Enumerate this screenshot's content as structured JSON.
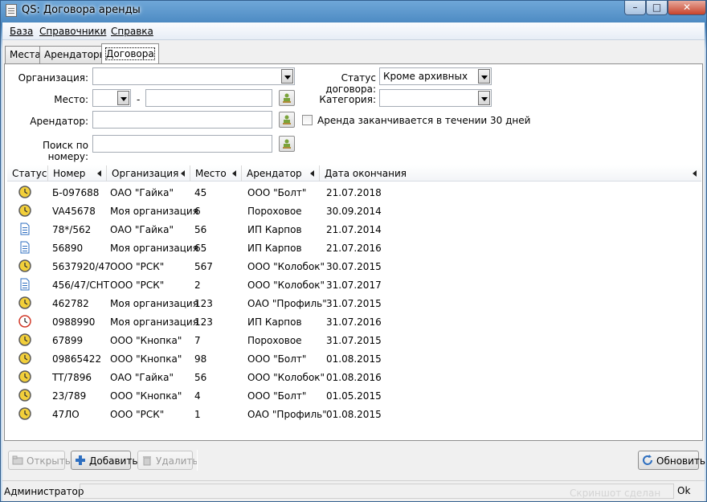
{
  "window": {
    "title": "QS: Договора аренды",
    "min_glyph": "–",
    "max_glyph": "□",
    "close_glyph": "✕"
  },
  "menu": [
    {
      "label": "База"
    },
    {
      "label": "Справочники"
    },
    {
      "label": "Справка"
    }
  ],
  "tabs": [
    {
      "label": "Места"
    },
    {
      "label": "Арендаторы"
    },
    {
      "label": "Договора"
    }
  ],
  "filters": {
    "org_label": "Организация:",
    "org_value": "",
    "place_label": "Место:",
    "place_value": "",
    "place_dash": "-",
    "place_value2": "",
    "tenant_label": "Арендатор:",
    "tenant_value": "",
    "search_label": "Поиск по номеру:",
    "search_value": "",
    "status_label": "Статус договора:",
    "status_value": "Кроме архивных",
    "category_label": "Категория:",
    "category_value": "",
    "ending_label": "Аренда заканчивается в течении 30 дней",
    "ending_checked": false
  },
  "table": {
    "columns": [
      "Статус",
      "Номер",
      "Организация",
      "Место",
      "Арендатор",
      "Дата окончания"
    ],
    "rows": [
      {
        "icon": "clock-yellow-icon",
        "number": "Б-097688",
        "org": "ОАО \"Гайка\"",
        "place": "45",
        "tenant": "ООО \"Болт\"",
        "date": "21.07.2018"
      },
      {
        "icon": "clock-yellow-icon",
        "number": "VA45678",
        "org": "Моя организация",
        "place": "6",
        "tenant": "Пороховое",
        "date": "30.09.2014"
      },
      {
        "icon": "document-blue-icon",
        "number": "78*/562",
        "org": "ОАО \"Гайка\"",
        "place": "56",
        "tenant": "ИП Карпов",
        "date": "21.07.2014"
      },
      {
        "icon": "document-blue-icon",
        "number": "56890",
        "org": "Моя организация",
        "place": "65",
        "tenant": "ИП Карпов",
        "date": "21.07.2016"
      },
      {
        "icon": "clock-yellow-icon",
        "number": "5637920/47",
        "org": "ООО \"РСК\"",
        "place": "567",
        "tenant": "ООО \"Колобок\"",
        "date": "30.07.2015"
      },
      {
        "icon": "document-blue-icon",
        "number": "456/47/CHT",
        "org": "ООО \"РСК\"",
        "place": "2",
        "tenant": "ООО \"Колобок\"",
        "date": "31.07.2017"
      },
      {
        "icon": "clock-yellow-icon",
        "number": "462782",
        "org": "Моя организация",
        "place": "123",
        "tenant": "ОАО \"Профиль\"",
        "date": "31.07.2015"
      },
      {
        "icon": "clock-red-icon",
        "number": "0988990",
        "org": "Моя организация",
        "place": "123",
        "tenant": "ИП Карпов",
        "date": "31.07.2016"
      },
      {
        "icon": "clock-yellow-icon",
        "number": "67899",
        "org": "ООО \"Кнопка\"",
        "place": "7",
        "tenant": "Пороховое",
        "date": "31.07.2015"
      },
      {
        "icon": "clock-yellow-icon",
        "number": "09865422",
        "org": "ООО \"Кнопка\"",
        "place": "98",
        "tenant": "ООО \"Болт\"",
        "date": "01.08.2015"
      },
      {
        "icon": "clock-yellow-icon",
        "number": "TT/7896",
        "org": "ОАО \"Гайка\"",
        "place": "56",
        "tenant": "ООО \"Колобок\"",
        "date": "01.08.2016"
      },
      {
        "icon": "clock-yellow-icon",
        "number": "23/789",
        "org": "ООО \"Кнопка\"",
        "place": "4",
        "tenant": "ООО \"Болт\"",
        "date": "01.05.2015"
      },
      {
        "icon": "clock-yellow-icon",
        "number": "47ЛО",
        "org": "ООО \"РСК\"",
        "place": "1",
        "tenant": "ОАО \"Профиль\"",
        "date": "01.08.2015"
      }
    ]
  },
  "buttons": {
    "open": "Открыть",
    "add": "Добавить",
    "delete": "Удалить",
    "refresh": "Обновить"
  },
  "status": {
    "user": "Администратор",
    "right": "Ok",
    "watermark": "Скриншот сделан"
  },
  "colors": {
    "accent": "#4f8cc4",
    "close": "#c7432b",
    "status_yellow": "#f2cf3a",
    "status_red": "#d23a2a",
    "document_blue": "#2f6fc0"
  }
}
